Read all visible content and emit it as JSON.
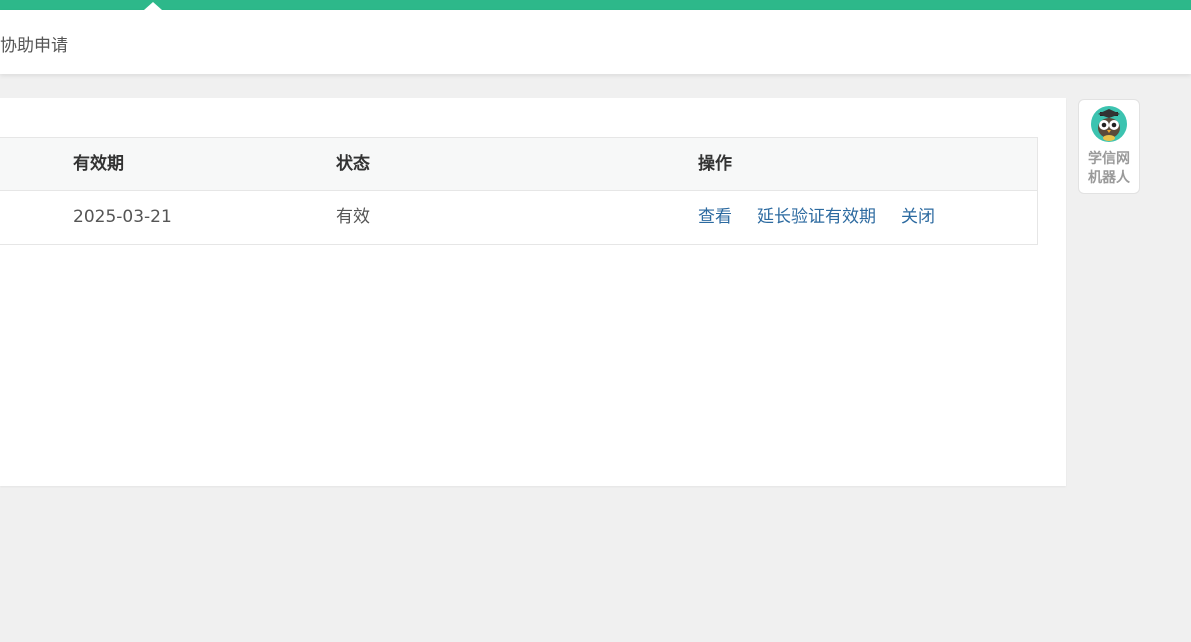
{
  "nav": {
    "item_label": "协助申请"
  },
  "table": {
    "headers": [
      "有效期",
      "状态",
      "操作"
    ],
    "rows": [
      {
        "expiry": "2025-03-21",
        "status": "有效",
        "actions": [
          "查看",
          "延长验证有效期",
          "关闭"
        ]
      }
    ]
  },
  "robot": {
    "label_line1": "学信网",
    "label_line2": "机器人",
    "icon": "owl-robot-icon"
  },
  "colors": {
    "brand": "#2db88a",
    "link": "#2c6aa0"
  }
}
